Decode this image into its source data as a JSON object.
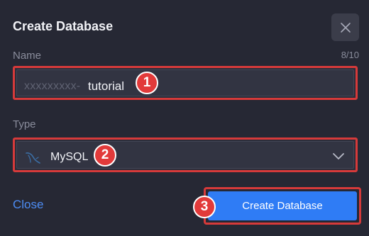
{
  "dialog": {
    "title": "Create Database",
    "close_icon": "close-icon"
  },
  "name": {
    "label": "Name",
    "counter": "8/10",
    "prefix": "xxxxxxxxx-",
    "value": "tutorial",
    "badge": "1"
  },
  "type": {
    "label": "Type",
    "icon": "mysql-dolphin-icon",
    "value": "MySQL",
    "badge": "2"
  },
  "actions": {
    "close_label": "Close",
    "create_label": "Create Database",
    "badge": "3"
  },
  "colors": {
    "background": "#262834",
    "highlight": "#d63a3a",
    "primary": "#2f7cf5",
    "link": "#4d8df5"
  }
}
